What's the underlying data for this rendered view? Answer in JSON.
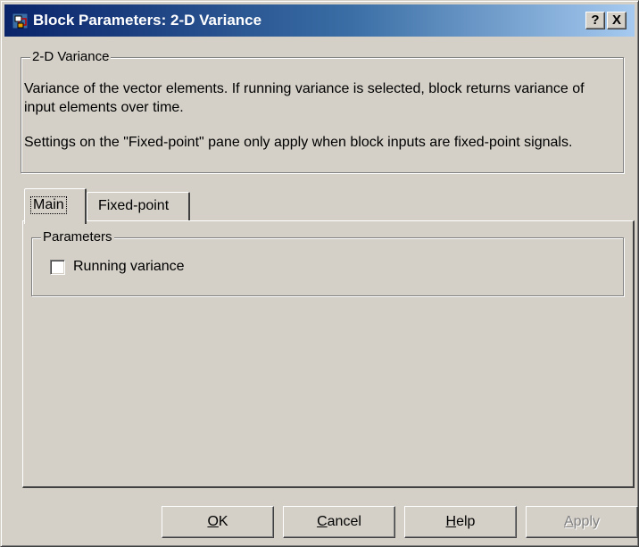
{
  "window": {
    "title": "Block Parameters: 2-D Variance",
    "help_button": "?",
    "close_button": "X"
  },
  "description": {
    "group_title": "2-D Variance",
    "line1": "Variance of the vector elements. If running variance is selected, block returns variance of input elements over time.",
    "line2": "Settings on the \"Fixed-point\" pane only apply when block inputs are fixed-point signals."
  },
  "tabs": [
    {
      "label": "Main",
      "selected": true
    },
    {
      "label": "Fixed-point",
      "selected": false
    }
  ],
  "parameters": {
    "group_title": "Parameters",
    "running_variance": {
      "label": "Running variance",
      "checked": false
    }
  },
  "buttons": {
    "ok": {
      "mnemonic": "O",
      "rest": "K",
      "enabled": true
    },
    "cancel": {
      "mnemonic": "C",
      "rest": "ancel",
      "enabled": true
    },
    "help": {
      "mnemonic": "H",
      "rest": "elp",
      "enabled": true
    },
    "apply": {
      "mnemonic": "A",
      "rest": "pply",
      "enabled": false
    }
  },
  "colors": {
    "face": "#d4d0c8",
    "title_start": "#0a246a",
    "title_end": "#a6caf0",
    "disabled_text": "#808080"
  }
}
